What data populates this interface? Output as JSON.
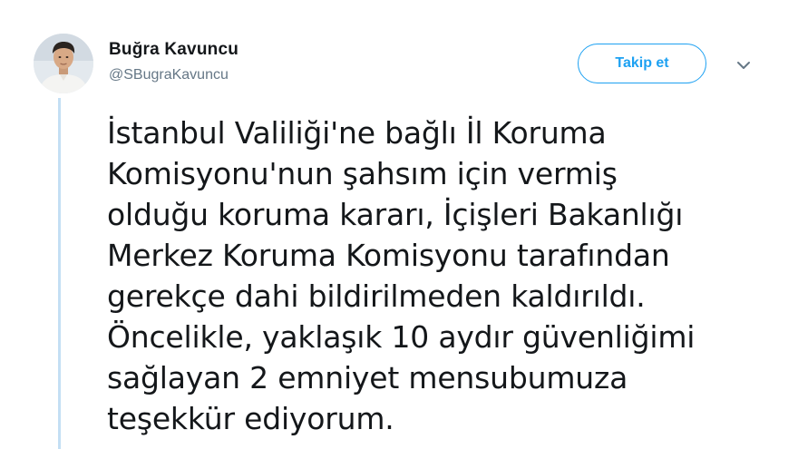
{
  "author": {
    "display_name": "Buğra Kavuncu",
    "handle": "@SBugraKavuncu"
  },
  "follow_button": {
    "label": "Takip et"
  },
  "icons": {
    "avatar": "profile-photo",
    "menu": "chevron-down-icon"
  },
  "tweet": {
    "lines": [
      "İstanbul Valiliği'ne bağlı İl Koruma",
      "Komisyonu'nun şahsım için vermiş",
      "olduğu koruma kararı, İçişleri Bakanlığı",
      "Merkez Koruma Komisyonu tarafından",
      "gerekçe dahi bildirilmeden kaldırıldı.",
      "Öncelikle, yaklaşık 10 aydır güvenliğimi",
      "sağlayan 2 emniyet mensubumuza",
      "teşekkür ediyorum."
    ]
  },
  "colors": {
    "accent": "#1da1f2",
    "thread_line": "#c4dff4",
    "text_primary": "#14171a",
    "text_secondary": "#657786"
  }
}
